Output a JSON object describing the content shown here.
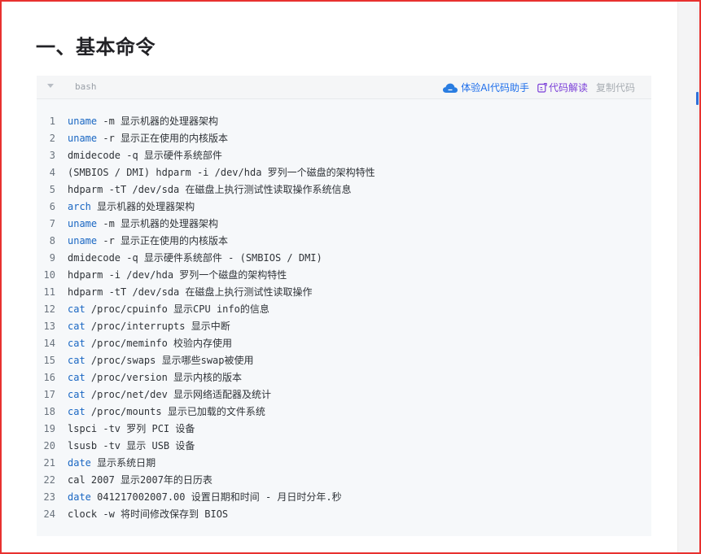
{
  "heading": "一、基本命令",
  "code": {
    "language": "bash",
    "actions": {
      "ai_helper": "体验AI代码助手",
      "explain": "代码解读",
      "copy": "复制代码"
    },
    "lines": [
      {
        "no": "1",
        "kw": "uname",
        "rest": " -m 显示机器的处理器架构"
      },
      {
        "no": "2",
        "kw": "uname",
        "rest": " -r 显示正在使用的内核版本"
      },
      {
        "no": "3",
        "kw": "",
        "rest": "dmidecode -q 显示硬件系统部件"
      },
      {
        "no": "4",
        "kw": "",
        "rest": "(SMBIOS / DMI) hdparm -i /dev/hda 罗列一个磁盘的架构特性"
      },
      {
        "no": "5",
        "kw": "",
        "rest": "hdparm -tT /dev/sda 在磁盘上执行测试性读取操作系统信息"
      },
      {
        "no": "6",
        "kw": "arch",
        "rest": " 显示机器的处理器架构"
      },
      {
        "no": "7",
        "kw": "uname",
        "rest": " -m 显示机器的处理器架构"
      },
      {
        "no": "8",
        "kw": "uname",
        "rest": " -r 显示正在使用的内核版本"
      },
      {
        "no": "9",
        "kw": "",
        "rest": "dmidecode -q 显示硬件系统部件 - (SMBIOS / DMI)"
      },
      {
        "no": "10",
        "kw": "",
        "rest": "hdparm -i /dev/hda 罗列一个磁盘的架构特性"
      },
      {
        "no": "11",
        "kw": "",
        "rest": "hdparm -tT /dev/sda 在磁盘上执行测试性读取操作"
      },
      {
        "no": "12",
        "kw": "cat",
        "rest": " /proc/cpuinfo 显示CPU info的信息"
      },
      {
        "no": "13",
        "kw": "cat",
        "rest": " /proc/interrupts 显示中断"
      },
      {
        "no": "14",
        "kw": "cat",
        "rest": " /proc/meminfo 校验内存使用"
      },
      {
        "no": "15",
        "kw": "cat",
        "rest": " /proc/swaps 显示哪些swap被使用"
      },
      {
        "no": "16",
        "kw": "cat",
        "rest": " /proc/version 显示内核的版本"
      },
      {
        "no": "17",
        "kw": "cat",
        "rest": " /proc/net/dev 显示网络适配器及统计"
      },
      {
        "no": "18",
        "kw": "cat",
        "rest": " /proc/mounts 显示已加载的文件系统"
      },
      {
        "no": "19",
        "kw": "",
        "rest": "lspci -tv 罗列 PCI 设备"
      },
      {
        "no": "20",
        "kw": "",
        "rest": "lsusb -tv 显示 USB 设备"
      },
      {
        "no": "21",
        "kw": "date",
        "rest": " 显示系统日期"
      },
      {
        "no": "22",
        "kw": "",
        "rest": "cal 2007 显示2007年的日历表"
      },
      {
        "no": "23",
        "kw": "date",
        "rest": " 041217002007.00 设置日期和时间 - 月日时分年.秒"
      },
      {
        "no": "24",
        "kw": "",
        "rest": "clock -w 将时间修改保存到 BIOS"
      }
    ]
  },
  "colors": {
    "keyword": "#1a67c3",
    "ai_action": "#1f6feb",
    "explain_action": "#7b3fd8",
    "frame_border": "#e8312f"
  }
}
